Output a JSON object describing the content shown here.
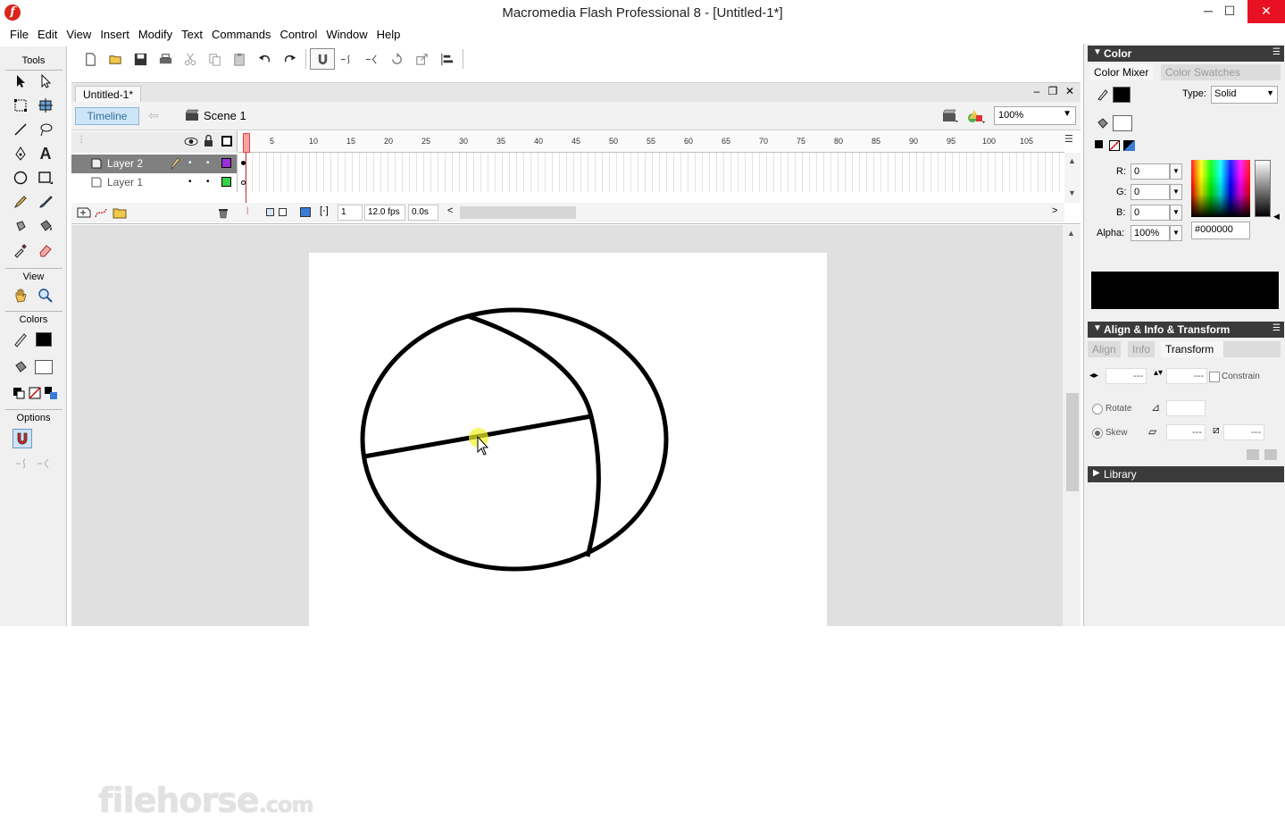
{
  "window": {
    "title": "Macromedia Flash Professional 8 - [Untitled-1*]",
    "logo_letter": "f",
    "minimize": "─",
    "maximize": "☐",
    "close": "✕"
  },
  "menu": [
    "File",
    "Edit",
    "View",
    "Insert",
    "Modify",
    "Text",
    "Commands",
    "Control",
    "Window",
    "Help"
  ],
  "tools": {
    "title": "Tools",
    "view_title": "View",
    "colors_title": "Colors",
    "options_title": "Options"
  },
  "document": {
    "tab": "Untitled-1*",
    "minimize": "–",
    "restore": "❐",
    "close": "✕",
    "timeline_button": "Timeline",
    "back_arrow": "⇦",
    "scene": "Scene 1",
    "zoom": "100%"
  },
  "timeline": {
    "layers": [
      {
        "name": "Layer 2",
        "selected": true,
        "outline_color": "#9b30d9"
      },
      {
        "name": "Layer 1",
        "selected": false,
        "outline_color": "#34d34a"
      }
    ],
    "ruler_ticks": [
      "5",
      "10",
      "15",
      "20",
      "25",
      "30",
      "35",
      "40",
      "45",
      "50",
      "55",
      "60",
      "65",
      "70",
      "75",
      "80",
      "85",
      "90",
      "95",
      "100",
      "105"
    ],
    "current_frame": "1",
    "fps": "12.0 fps",
    "elapsed": "0.0s"
  },
  "color_panel": {
    "title": "Color",
    "tab_mixer": "Color Mixer",
    "tab_swatches": "Color Swatches",
    "type_label": "Type:",
    "type_value": "Solid",
    "r_label": "R:",
    "g_label": "G:",
    "b_label": "B:",
    "alpha_label": "Alpha:",
    "r": "0",
    "g": "0",
    "b": "0",
    "alpha": "100%",
    "hex": "#000000",
    "preview_color": "#000000"
  },
  "transform_panel": {
    "title": "Align & Info & Transform",
    "tab_align": "Align",
    "tab_info": "Info",
    "tab_transform": "Transform",
    "width_value": "---",
    "height_value": "---",
    "constrain": "Constrain",
    "rotate": "Rotate",
    "skew": "Skew",
    "skew_h": "---",
    "skew_v": "---"
  },
  "library_panel": {
    "title": "Library"
  },
  "watermark": {
    "brand": "filehorse",
    "suffix": ".com"
  }
}
